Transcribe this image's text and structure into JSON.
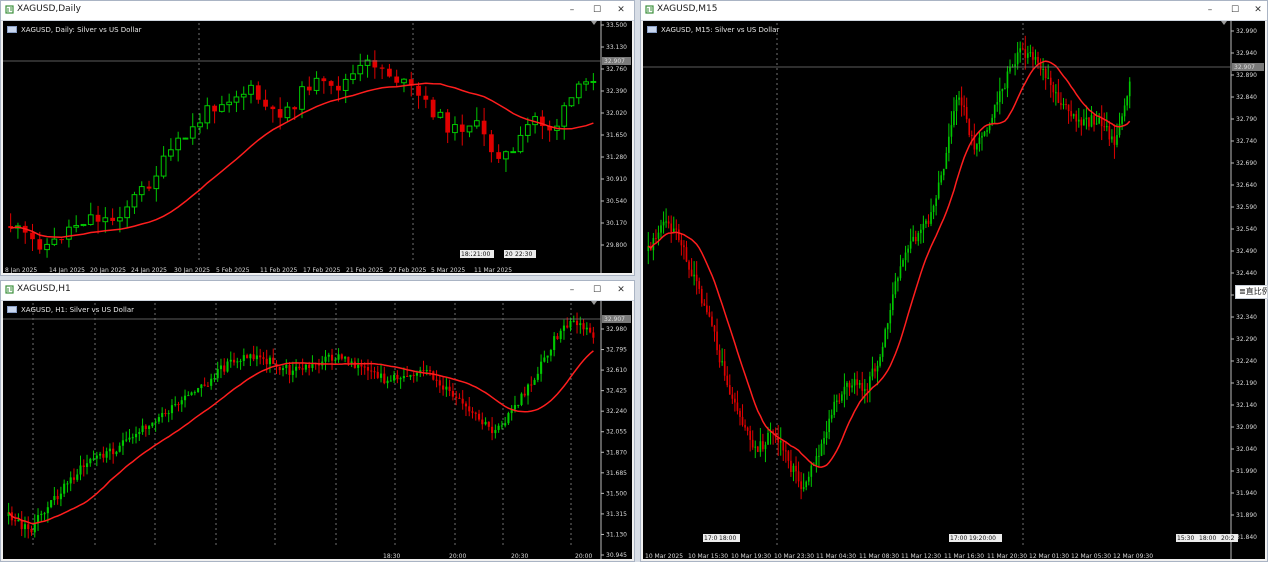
{
  "windows": {
    "daily": {
      "title": "XAGUSD,Daily",
      "caption": "XAGUSD, Daily:  Silver vs US Dollar",
      "current_price": "32.907",
      "price_labels": [
        "33.500",
        "33.130",
        "32.760",
        "32.390",
        "32.020",
        "31.650",
        "31.280",
        "30.910",
        "30.540",
        "30.170",
        "29.800"
      ],
      "time_labels": [
        "8 Jan 2025",
        "14 Jan 2025",
        "20 Jan 2025",
        "24 Jan 2025",
        "30 Jan 2025",
        "5 Feb 2025",
        "11 Feb 2025",
        "17 Feb 2025",
        "21 Feb 2025",
        "27 Feb 2025",
        "5 Mar 2025",
        "11 Mar 2025"
      ],
      "crosshair_labels": [
        "18:20",
        "21:00",
        "20",
        "22:30"
      ]
    },
    "h1": {
      "title": "XAGUSD,H1",
      "caption": "XAGUSD, H1:  Silver vs US Dollar",
      "current_price": "32.907",
      "price_labels": [
        "32.980",
        "32.795",
        "32.610",
        "32.425",
        "32.240",
        "32.055",
        "31.870",
        "31.685",
        "31.500",
        "31.315",
        "31.130",
        "30.945"
      ],
      "time_labels": [
        "18:30",
        "20:00",
        "20:30",
        "20:00"
      ]
    },
    "m15": {
      "title": "XAGUSD,M15",
      "caption": "XAGUSD, M15:  Silver vs US Dollar",
      "current_price": "32.907",
      "price_labels": [
        "32.990",
        "32.940",
        "32.890",
        "32.840",
        "32.790",
        "32.740",
        "32.690",
        "32.640",
        "32.590",
        "32.540",
        "32.490",
        "32.440",
        "32.390",
        "32.340",
        "32.290",
        "32.240",
        "32.190",
        "32.140",
        "32.090",
        "32.040",
        "31.990",
        "31.940",
        "31.890",
        "31.840"
      ],
      "time_labels": [
        "10 Mar 2025",
        "10 Mar 15:30",
        "10 Mar 19:30",
        "10 Mar 23:30",
        "11 Mar 04:30",
        "11 Mar 08:30",
        "11 Mar 12:30",
        "11 Mar 16:30",
        "11 Mar 20:30",
        "12 Mar 01:30",
        "12 Mar 05:30",
        "12 Mar 09:30"
      ],
      "time_marks": [
        "17:00",
        "18:00",
        "17:00",
        "19:20:00",
        "15:30",
        "18:00",
        "20:2"
      ],
      "side_button": "≣直比例"
    }
  },
  "colors": {
    "bull": "#00c800",
    "bear": "#e00000",
    "ma": "#ff1e1e",
    "grid": "#8c8c8c",
    "price_line": "#7a7a7a",
    "background": "#000000"
  },
  "icons": {
    "window": "chart-window-icon",
    "minimize": "minimize-icon",
    "maximize": "maximize-icon",
    "close": "close-icon"
  }
}
